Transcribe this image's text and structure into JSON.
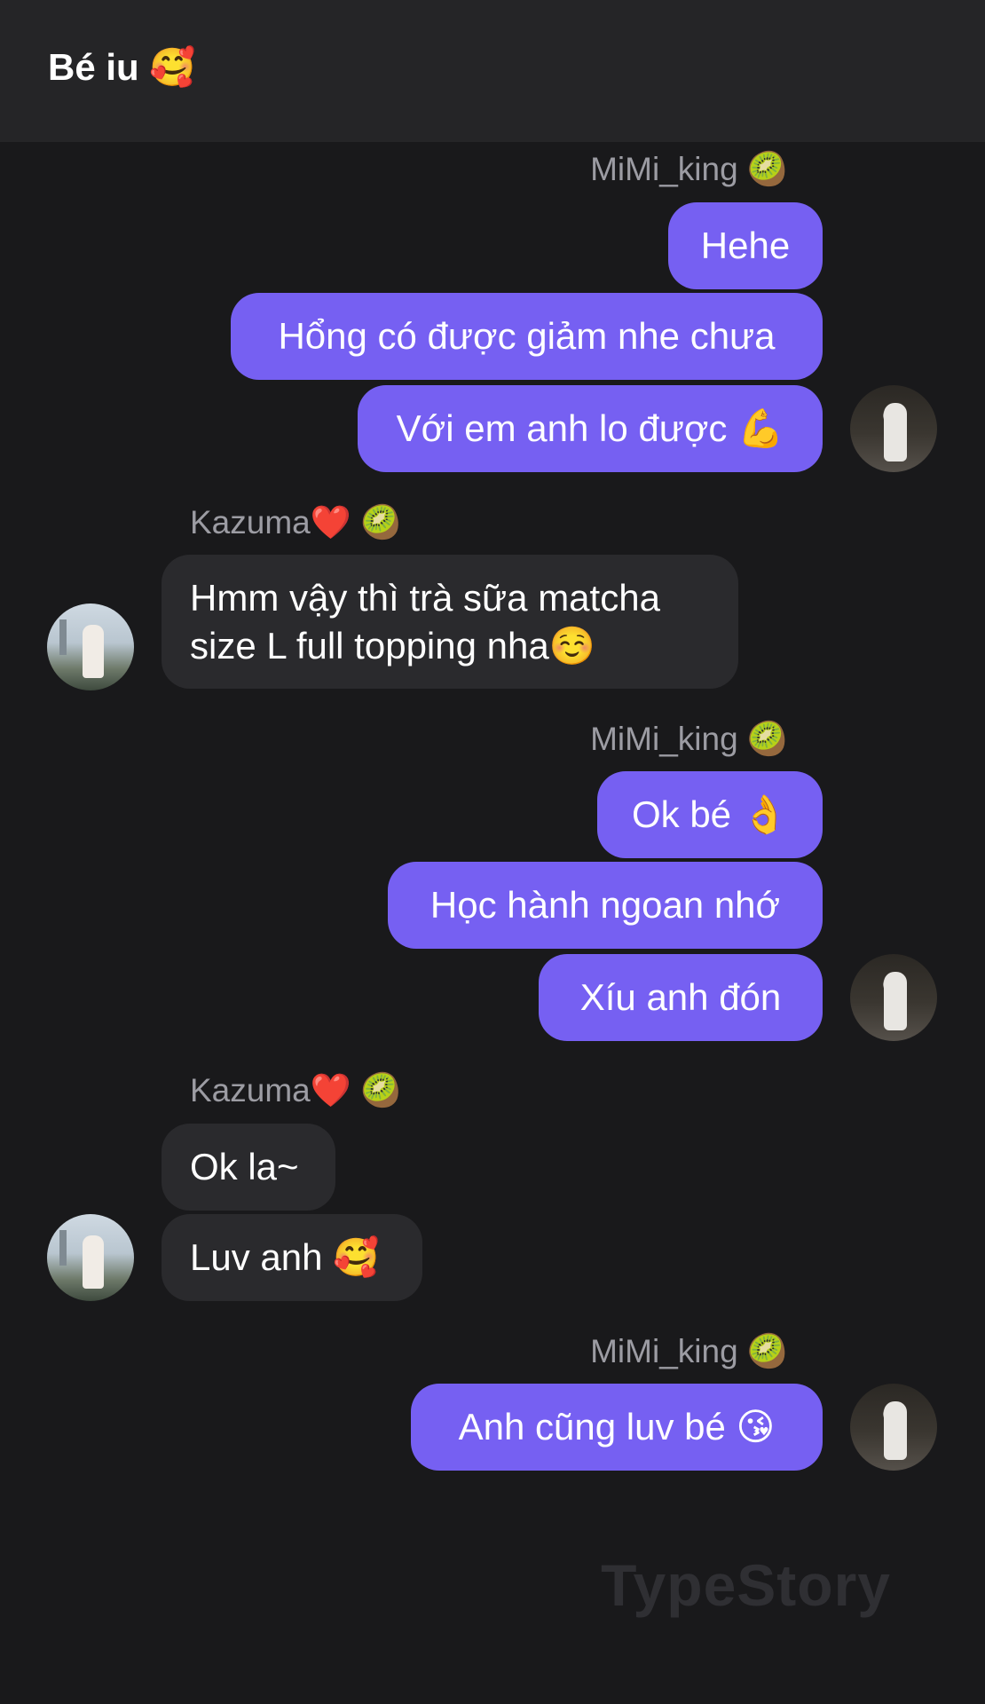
{
  "header": {
    "title": "Bé iu 🥰"
  },
  "messages": {
    "group1": {
      "sender": "MiMi_king 🥝",
      "bubbles": [
        "Hehe",
        "Hổng có được giảm nhe chưa",
        "Với em anh lo được 💪"
      ]
    },
    "group2": {
      "sender": "Kazuma❤️ 🥝",
      "bubbles": [
        "Hmm vậy thì trà sữa matcha size L full topping nha☺️"
      ]
    },
    "group3": {
      "sender": "MiMi_king 🥝",
      "bubbles": [
        "Ok bé 👌",
        "Học hành ngoan nhớ",
        "Xíu anh đón"
      ]
    },
    "group4": {
      "sender": "Kazuma❤️ 🥝",
      "bubbles": [
        "Ok la~",
        "Luv anh 🥰"
      ]
    },
    "group5": {
      "sender": "MiMi_king 🥝",
      "bubbles": [
        "Anh cũng luv bé 😘"
      ]
    }
  },
  "watermark": "TypeStory",
  "colors": {
    "background": "#19191b",
    "header": "#252527",
    "outgoing_bubble": "#7660f2",
    "incoming_bubble": "#2a2a2d",
    "sender_name": "#9c9ca3"
  }
}
